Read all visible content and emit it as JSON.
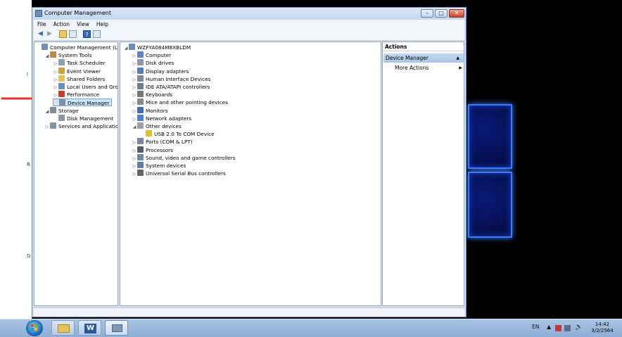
{
  "window": {
    "title": "Computer Management",
    "buttons": {
      "minimize": "–",
      "maximize": "□",
      "close": "✕"
    }
  },
  "menu": [
    "File",
    "Action",
    "View",
    "Help"
  ],
  "left_tree": [
    {
      "label": "Computer Management (Local",
      "depth": 0,
      "arrow": "",
      "icon": "computer-management-icon",
      "color": "#6f8fb2"
    },
    {
      "label": "System Tools",
      "depth": 1,
      "arrow": "◢",
      "icon": "system-tools-icon",
      "color": "#b98b3a"
    },
    {
      "label": "Task Scheduler",
      "depth": 2,
      "arrow": "▷",
      "icon": "clock-icon",
      "color": "#8aa0b6"
    },
    {
      "label": "Event Viewer",
      "depth": 2,
      "arrow": "▷",
      "icon": "event-viewer-icon",
      "color": "#c9a13d"
    },
    {
      "label": "Shared Folders",
      "depth": 2,
      "arrow": "▷",
      "icon": "shared-folder-icon",
      "color": "#e3c25a"
    },
    {
      "label": "Local Users and Groups",
      "depth": 2,
      "arrow": "▷",
      "icon": "users-icon",
      "color": "#6c8fb8"
    },
    {
      "label": "Performance",
      "depth": 2,
      "arrow": "▷",
      "icon": "performance-icon",
      "color": "#cc3a2a"
    },
    {
      "label": "Device Manager",
      "depth": 2,
      "arrow": "",
      "icon": "device-manager-icon",
      "color": "#7d8fa3",
      "selected": true
    },
    {
      "label": "Storage",
      "depth": 1,
      "arrow": "◢",
      "icon": "storage-icon",
      "color": "#7f8c99"
    },
    {
      "label": "Disk Management",
      "depth": 2,
      "arrow": "",
      "icon": "disk-icon",
      "color": "#8d98a6"
    },
    {
      "label": "Services and Applications",
      "depth": 1,
      "arrow": "▷",
      "icon": "services-icon",
      "color": "#7d94ad"
    }
  ],
  "device_tree": [
    {
      "label": "WZFYA084M8XBLDM",
      "depth": 0,
      "arrow": "◢",
      "icon": "computer-icon",
      "color": "#6c8fb8"
    },
    {
      "label": "Computer",
      "depth": 1,
      "arrow": "▷",
      "icon": "computer-icon",
      "color": "#5b86c2"
    },
    {
      "label": "Disk drives",
      "depth": 1,
      "arrow": "▷",
      "icon": "disk-drive-icon",
      "color": "#8f99a4"
    },
    {
      "label": "Display adapters",
      "depth": 1,
      "arrow": "▷",
      "icon": "display-adapter-icon",
      "color": "#4f7fb8"
    },
    {
      "label": "Human Interface Devices",
      "depth": 1,
      "arrow": "▷",
      "icon": "hid-icon",
      "color": "#7d8a96"
    },
    {
      "label": "IDE ATA/ATAPI controllers",
      "depth": 1,
      "arrow": "▷",
      "icon": "ide-controller-icon",
      "color": "#6e7d8c"
    },
    {
      "label": "Keyboards",
      "depth": 1,
      "arrow": "▷",
      "icon": "keyboard-icon",
      "color": "#777"
    },
    {
      "label": "Mice and other pointing devices",
      "depth": 1,
      "arrow": "▷",
      "icon": "mouse-icon",
      "color": "#888"
    },
    {
      "label": "Monitors",
      "depth": 1,
      "arrow": "▷",
      "icon": "monitor-icon",
      "color": "#3e6fae"
    },
    {
      "label": "Network adapters",
      "depth": 1,
      "arrow": "▷",
      "icon": "network-adapter-icon",
      "color": "#4f83bf"
    },
    {
      "label": "Other devices",
      "depth": 1,
      "arrow": "◢",
      "icon": "other-devices-icon",
      "color": "#9aa3ad"
    },
    {
      "label": "USB 2.0 To COM Device",
      "depth": 2,
      "arrow": "",
      "icon": "warning-device-icon",
      "color": "#e5c02a"
    },
    {
      "label": "Ports (COM & LPT)",
      "depth": 1,
      "arrow": "▷",
      "icon": "port-icon",
      "color": "#7d8894"
    },
    {
      "label": "Processors",
      "depth": 1,
      "arrow": "▷",
      "icon": "processor-icon",
      "color": "#555f69"
    },
    {
      "label": "Sound, video and game controllers",
      "depth": 1,
      "arrow": "▷",
      "icon": "sound-icon",
      "color": "#6e88a8"
    },
    {
      "label": "System devices",
      "depth": 1,
      "arrow": "▷",
      "icon": "system-device-icon",
      "color": "#5b7fae"
    },
    {
      "label": "Universal Serial Bus controllers",
      "depth": 1,
      "arrow": "▷",
      "icon": "usb-icon",
      "color": "#666"
    }
  ],
  "actions": {
    "heading": "Actions",
    "section": "Device Manager",
    "section_arrow": "▲",
    "item": "More Actions",
    "item_arrow": "▶"
  },
  "taskbar": {
    "language": "EN",
    "time": "14:42",
    "date": "3/2/2564"
  }
}
